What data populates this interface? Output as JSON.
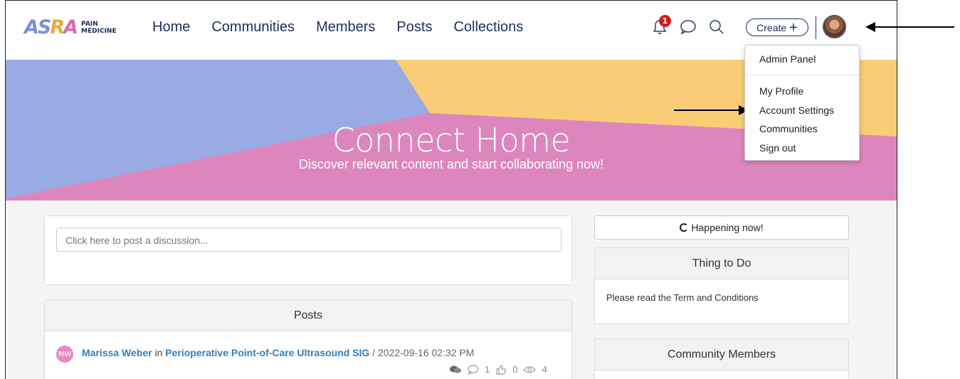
{
  "header": {
    "logo_main": [
      "AS",
      "R",
      "A"
    ],
    "logo_sub_line1": "PAIN",
    "logo_sub_line2": "MEDICINE",
    "nav": [
      "Home",
      "Communities",
      "Members",
      "Posts",
      "Collections"
    ],
    "notifications_count": "1",
    "create_label": "Create",
    "create_plus": "+"
  },
  "icons": {
    "bell": "bell-icon",
    "chat": "chat-icon",
    "search": "search-icon",
    "avatar": "user-avatar"
  },
  "dropdown": {
    "items": [
      "Admin Panel",
      "My Profile",
      "Account Settings",
      "Communities",
      "Sign out"
    ]
  },
  "hero": {
    "title": "Connect Home",
    "subtitle": "Discover relevant content and start collaborating now!",
    "colors": {
      "blue": "#9aaae2",
      "yellow": "#f9cd75",
      "pink": "#dd86bd"
    }
  },
  "composer": {
    "placeholder": "Click here to post a discussion..."
  },
  "posts": {
    "title": "Posts",
    "items": [
      {
        "initials": "MW",
        "author": "Marissa Weber",
        "connector": "in",
        "community": "Perioperative Point-of-Care Ultrasound SIG",
        "date": "/ 2022-09-16 02:32 PM",
        "comments": "1",
        "likes": "0",
        "views": "4"
      }
    ]
  },
  "sidebar": {
    "happening": "Happening now!",
    "todo_title": "Thing to Do",
    "todo_text": "Please read the Term and Conditions",
    "members_title": "Community Members"
  }
}
